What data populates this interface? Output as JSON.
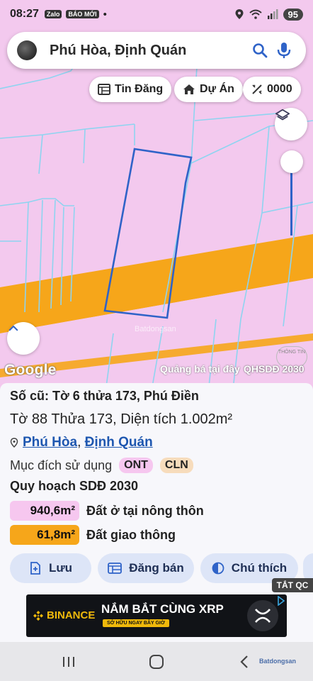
{
  "status_bar": {
    "time": "08:27",
    "app_icons": [
      "Zalo",
      "BÁO MỚI"
    ],
    "dot": "•",
    "battery": "95"
  },
  "search": {
    "text": "Phú Hòa, Định Quán"
  },
  "chips": [
    {
      "label": "Tin Đăng",
      "icon": "listing-icon"
    },
    {
      "label": "Dự Án",
      "icon": "house-icon"
    },
    {
      "label": "0000",
      "icon": "measure-icon"
    }
  ],
  "map": {
    "google": "Google",
    "ad_text": "Quảng bá tại đây",
    "plan_label": "QHSDĐ 2030",
    "thong_tin": "THÔNG TIN",
    "watermark": "Batdongsan",
    "colors": {
      "land": "#f3c9ee",
      "road": "#f6a61a",
      "parcel_line": "#8ed4f0",
      "selected": "#2f63c8"
    }
  },
  "panel": {
    "old_plot": "Số cũ: Tờ 6 thửa 173, Phú Điền",
    "plot_info": "Tờ 88 Thửa 173, Diện tích 1.002m²",
    "location_ward": "Phú Hòa",
    "location_sep": ",",
    "location_district": "Định Quán",
    "purpose_label": "Mục đích sử dụng",
    "tags": [
      "ONT",
      "CLN"
    ],
    "plan_title": "Quy hoạch SDĐ 2030",
    "areas": [
      {
        "value": "940,6m²",
        "label": "Đất ở tại nông thôn",
        "color": "#f6c7ef"
      },
      {
        "value": "61,8m²",
        "label": "Đất giao thông",
        "color": "#f6a61a"
      }
    ],
    "actions": [
      {
        "label": "Lưu",
        "icon": "save-icon"
      },
      {
        "label": "Đăng bán",
        "icon": "post-icon"
      },
      {
        "label": "Chú thích",
        "icon": "legend-icon"
      }
    ]
  },
  "ad": {
    "close_label": "TẮT QC",
    "brand": "BINANCE",
    "headline": "NẮM BẮT CÙNG XRP",
    "cta": "SỞ HỮU NGAY BÂY GIỜ"
  },
  "nav": {
    "brand": "Batdongsan"
  }
}
